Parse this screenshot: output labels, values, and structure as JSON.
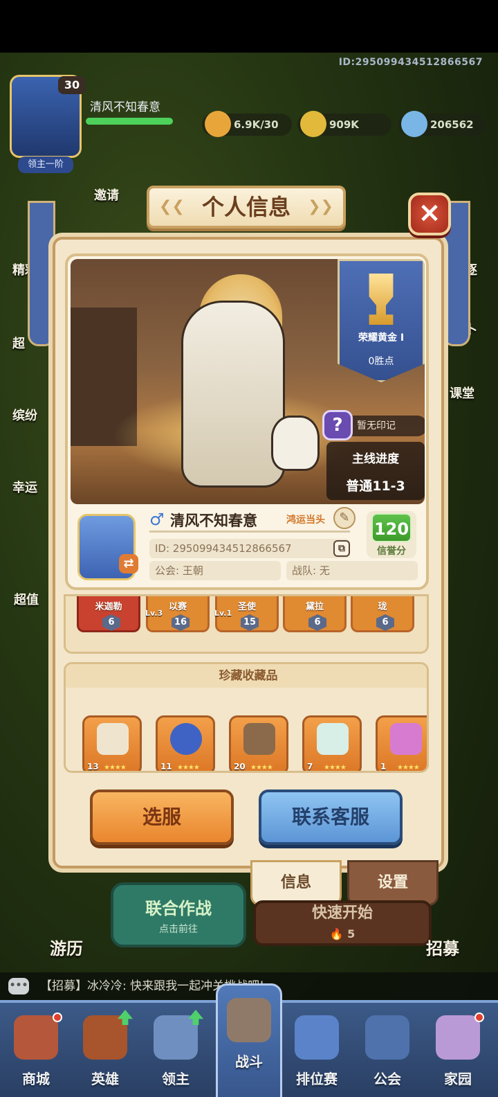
{
  "hud": {
    "player_id": "ID:295099434512866567",
    "lord_level": "30",
    "lord_rank": "领主一阶",
    "lord_name": "清风不知春意",
    "resources": [
      {
        "icon": "stamina-icon",
        "value": "6.9K/30"
      },
      {
        "icon": "gold-coin-icon",
        "value": "909K"
      },
      {
        "icon": "crystal-icon",
        "value": "206562"
      }
    ],
    "left_menu": [
      "邀请",
      "精彩",
      "超",
      "缤纷",
      "幸运",
      "超值"
    ],
    "right_menu": [
      "角逐",
      "占卜",
      "课堂"
    ]
  },
  "modal": {
    "title": "个人信息",
    "close_icon": "close-icon"
  },
  "profile": {
    "rank_name": "荣耀黄金 I",
    "rank_points": "0胜点",
    "mark_text": "暂无印记",
    "mark_icon": "question-icon",
    "progress_label": "主线进度",
    "progress_value": "普通11-3",
    "gender_symbol": "♂",
    "player_name": "清风不知春意",
    "title_tag": "鸿运当头",
    "id_text": "ID:  295099434512866567",
    "guild_text": "公会:  王朝",
    "team_text": "战队:  无",
    "credit_value": "120",
    "credit_label": "信誉分"
  },
  "heroes": [
    {
      "name": "米迦勒",
      "level": "",
      "stars": "6",
      "color": "red"
    },
    {
      "name": "以赛",
      "level": "Lv.3",
      "stars": "16",
      "color": "orange"
    },
    {
      "name": "圣使",
      "level": "Lv.1",
      "stars": "15",
      "color": "orange"
    },
    {
      "name": "黛拉",
      "level": "",
      "stars": "6",
      "color": "orange"
    },
    {
      "name": "珑",
      "level": "",
      "stars": "6",
      "color": "orange"
    }
  ],
  "collectibles": {
    "title": "珍藏收藏品",
    "items": [
      {
        "icon": "scroll-icon",
        "count": "13",
        "stars": "★★★★"
      },
      {
        "icon": "blue-orb-icon",
        "count": "11",
        "stars": "★★★★"
      },
      {
        "icon": "hammer-icon",
        "count": "20",
        "stars": "★★★★"
      },
      {
        "icon": "feather-icon",
        "count": "7",
        "stars": "★★★★"
      },
      {
        "icon": "butterfly-icon",
        "count": "1",
        "stars": "★★★★"
      }
    ]
  },
  "buttons": {
    "select_server": "选服",
    "contact_support": "联系客服"
  },
  "tabs": {
    "info": "信息",
    "settings": "设置"
  },
  "lower": {
    "coop_title": "联合作战",
    "coop_sub": "点击前往",
    "quick_start": "快速开始",
    "quick_cost": "5",
    "journey": "游历",
    "recruit": "招募"
  },
  "chat": {
    "message": "【招募】冰冷冷: 快来跟我一起冲关挑战吧!"
  },
  "nav": [
    {
      "label": "商城",
      "icon": "shop-icon"
    },
    {
      "label": "英雄",
      "icon": "hero-card-icon"
    },
    {
      "label": "领主",
      "icon": "lord-icon"
    },
    {
      "label": "战斗",
      "icon": "battle-icon"
    },
    {
      "label": "排位赛",
      "icon": "ranked-icon"
    },
    {
      "label": "公会",
      "icon": "guild-icon"
    },
    {
      "label": "家园",
      "icon": "home-icon"
    }
  ],
  "colors": {
    "panel": "#f3e6cb",
    "accent_orange": "#e9862e",
    "accent_blue": "#5c95d6",
    "credit_green": "#3d9a2b",
    "nav_bg": "#2a3f63"
  }
}
